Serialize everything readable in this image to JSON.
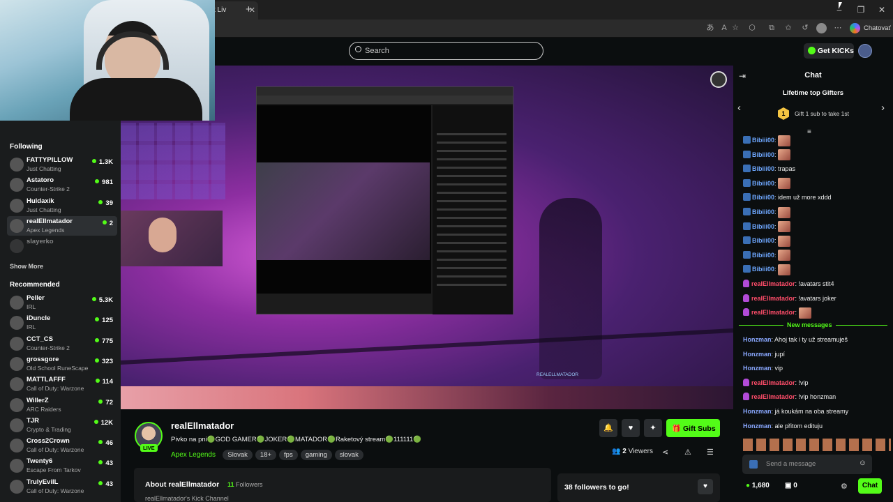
{
  "browser": {
    "tab_title": "t Liv",
    "profile_label": "Chatovať",
    "colors": {
      "tabbar": "#1f1f1f",
      "address": "#2b2b2b"
    }
  },
  "header": {
    "search_placeholder": "Search",
    "get_kicks_label": "Get KICKs"
  },
  "sidebar": {
    "following_title": "Following",
    "following": [
      {
        "name": "FATTYPILLOW",
        "category": "Just Chatting",
        "viewers": "1.3K"
      },
      {
        "name": "Astatoro",
        "category": "Counter-Strike 2",
        "viewers": "981"
      },
      {
        "name": "Huldaxik",
        "category": "Just Chatting",
        "viewers": "39"
      },
      {
        "name": "realEllmatador",
        "category": "Apex Legends",
        "viewers": "2"
      },
      {
        "name": "slayerko",
        "category": "",
        "viewers": ""
      }
    ],
    "show_more": "Show More",
    "recommended_title": "Recommended",
    "recommended": [
      {
        "name": "Peller",
        "category": "IRL",
        "viewers": "5.3K"
      },
      {
        "name": "iDuncle",
        "category": "IRL",
        "viewers": "125"
      },
      {
        "name": "CCT_CS",
        "category": "Counter-Strike 2",
        "viewers": "775"
      },
      {
        "name": "grossgore",
        "category": "Old School RuneScape",
        "viewers": "323"
      },
      {
        "name": "MATTLAFFF",
        "category": "Call of Duty: Warzone",
        "viewers": "114"
      },
      {
        "name": "WillerZ",
        "category": "ARC Raiders",
        "viewers": "72"
      },
      {
        "name": "TJR",
        "category": "Crypto & Trading",
        "viewers": "12K"
      },
      {
        "name": "Cross2Crown",
        "category": "Call of Duty: Warzone",
        "viewers": "46"
      },
      {
        "name": "Twenty6",
        "category": "Escape From Tarkov",
        "viewers": "43"
      },
      {
        "name": "TrulyEvilL",
        "category": "Call of Duty: Warzone",
        "viewers": "43"
      }
    ]
  },
  "stream": {
    "overlay_name": "REALELLMATADOR",
    "streamer": "realEllmatador",
    "live_badge": "LIVE",
    "title": "Pivko na pni🟢GOD GAMER🟢JOKER🟢MATADOR🟢Raketový stream🟢111111🟢",
    "category": "Apex Legends",
    "tags": [
      "Slovak",
      "18+",
      "fps",
      "gaming",
      "slovak"
    ],
    "viewers_count": "2",
    "viewers_label": "Viewers",
    "gift_subs_label": "Gift Subs",
    "about_title": "About realEllmatador",
    "followers_count": "11",
    "followers_label": "Followers",
    "about_text": "realEllmatador's Kick Channel",
    "goal_text": "38 followers to go!"
  },
  "chat": {
    "title": "Chat",
    "gifters_title": "Lifetime top Gifters",
    "gifter_rank": "1",
    "gifter_text": "Gift 1 sub to take 1st",
    "messages": [
      {
        "user": "Bibiii00",
        "text": "",
        "emote": true,
        "color": "#6fa8ff",
        "badge": "kick"
      },
      {
        "user": "Bibiii00",
        "text": "",
        "emote": true,
        "color": "#6fa8ff",
        "badge": "kick"
      },
      {
        "user": "Bibiii00",
        "text": "trapas",
        "emote": false,
        "color": "#6fa8ff",
        "badge": "kick"
      },
      {
        "user": "Bibiii00",
        "text": "",
        "emote": true,
        "color": "#6fa8ff",
        "badge": "kick"
      },
      {
        "user": "Bibiii00",
        "text": "idem už more xddd",
        "emote": false,
        "color": "#6fa8ff",
        "badge": "kick"
      },
      {
        "user": "Bibiii00",
        "text": "",
        "emote": true,
        "color": "#6fa8ff",
        "badge": "kick"
      },
      {
        "user": "Bibiii00",
        "text": "",
        "emote": true,
        "color": "#6fa8ff",
        "badge": "kick"
      },
      {
        "user": "Bibiii00",
        "text": "",
        "emote": true,
        "color": "#6fa8ff",
        "badge": "kick"
      },
      {
        "user": "Bibiii00",
        "text": "",
        "emote": true,
        "color": "#6fa8ff",
        "badge": "kick"
      },
      {
        "user": "Bibiii00",
        "text": "",
        "emote": true,
        "color": "#6fa8ff",
        "badge": "kick"
      },
      {
        "user": "realEllmatador",
        "text": "!avatars stit4",
        "emote": false,
        "color": "#ff4d6a",
        "badge": "mic"
      },
      {
        "user": "realEllmatador",
        "text": "!avatars joker",
        "emote": false,
        "color": "#ff4d6a",
        "badge": "mic"
      },
      {
        "user": "realEllmatador",
        "text": "",
        "emote": true,
        "color": "#ff4d6a",
        "badge": "mic"
      }
    ],
    "new_messages_label": "New messages",
    "new_messages": [
      {
        "user": "Honzman",
        "text": "Ahoj tak i ty už streamuješ",
        "color": "#8aa8ff",
        "badge": ""
      },
      {
        "user": "Honzman",
        "text": "jupí",
        "color": "#8aa8ff",
        "badge": ""
      },
      {
        "user": "Honzman",
        "text": "vip",
        "color": "#8aa8ff",
        "badge": ""
      },
      {
        "user": "realEllmatador",
        "text": "!vip",
        "color": "#ff4d6a",
        "badge": "mic"
      },
      {
        "user": "realEllmatador",
        "text": "!vip honzman",
        "color": "#ff4d6a",
        "badge": "mic"
      },
      {
        "user": "Honzman",
        "text": "já koukám na oba streamy",
        "color": "#8aa8ff",
        "badge": ""
      },
      {
        "user": "Honzman",
        "text": "ale přitom edituju",
        "color": "#8aa8ff",
        "badge": ""
      }
    ],
    "input_placeholder": "Send a message",
    "points": "1,680",
    "subs": "0",
    "send_label": "Chat",
    "accent": "#53fc18"
  }
}
